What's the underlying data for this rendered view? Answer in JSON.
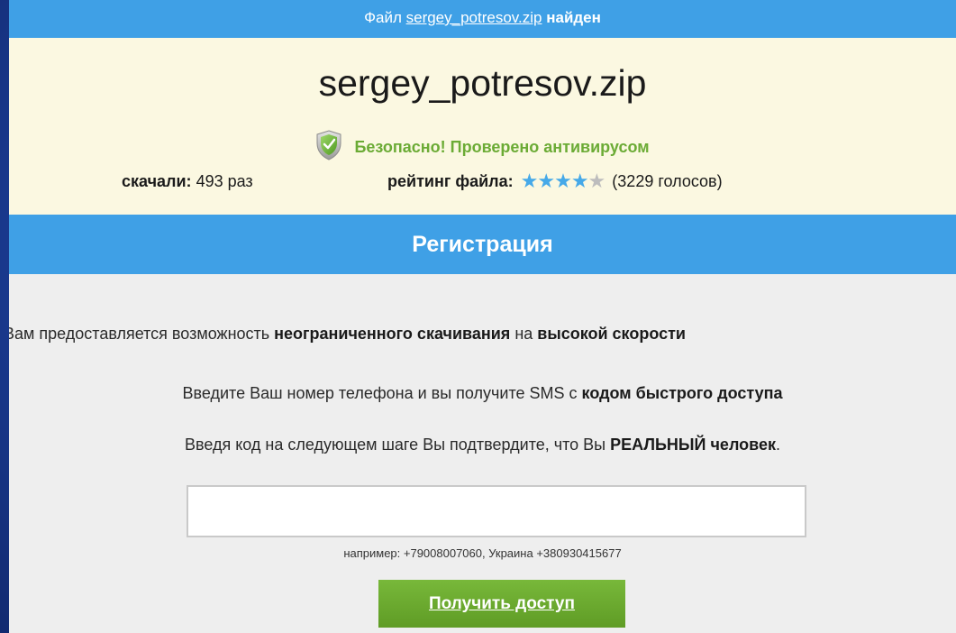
{
  "topbar": {
    "prefix": "Файл",
    "filename": "sergey_potresov.zip",
    "suffix": "найден"
  },
  "file": {
    "title": "sergey_potresov.zip",
    "safe_text": "Безопасно! Проверено антивирусом"
  },
  "stats": {
    "downloads_label": "скачали:",
    "downloads_value": "493 раз",
    "rating_label": "рейтинг файла:",
    "rating_stars_filled": 4,
    "rating_stars_total": 5,
    "votes": "(3229 голосов)"
  },
  "registration": {
    "header": "Регистрация",
    "line1": {
      "t1": "Вам предоставляется возможность ",
      "b1": "неограниченного скачивания",
      "t2": " на ",
      "b2": "высокой скорости"
    },
    "line2": {
      "t1": "Введите Ваш номер телефона и вы получите SMS с ",
      "b1": "кодом быстрого доступа"
    },
    "line3": {
      "t1": "Введя код на следующем шаге Вы подтвердите, что Вы ",
      "b1": "РЕАЛЬНЫЙ человек",
      "t2": "."
    },
    "phone_value": "",
    "phone_placeholder": "",
    "hint": "например: +79008007060, Украина +380930415677",
    "button_label": "Получить доступ"
  },
  "colors": {
    "accent_blue": "#3fa0e6",
    "cream": "#fbf8e1",
    "safe_green": "#6bab35",
    "button_green": "#6aa92f",
    "star_blue": "#46a9e8",
    "star_gray": "#bdbdbd",
    "background_blue": "#1d3f9a"
  },
  "icons": {
    "safe": "shield-check-icon",
    "star": "star-icon"
  }
}
